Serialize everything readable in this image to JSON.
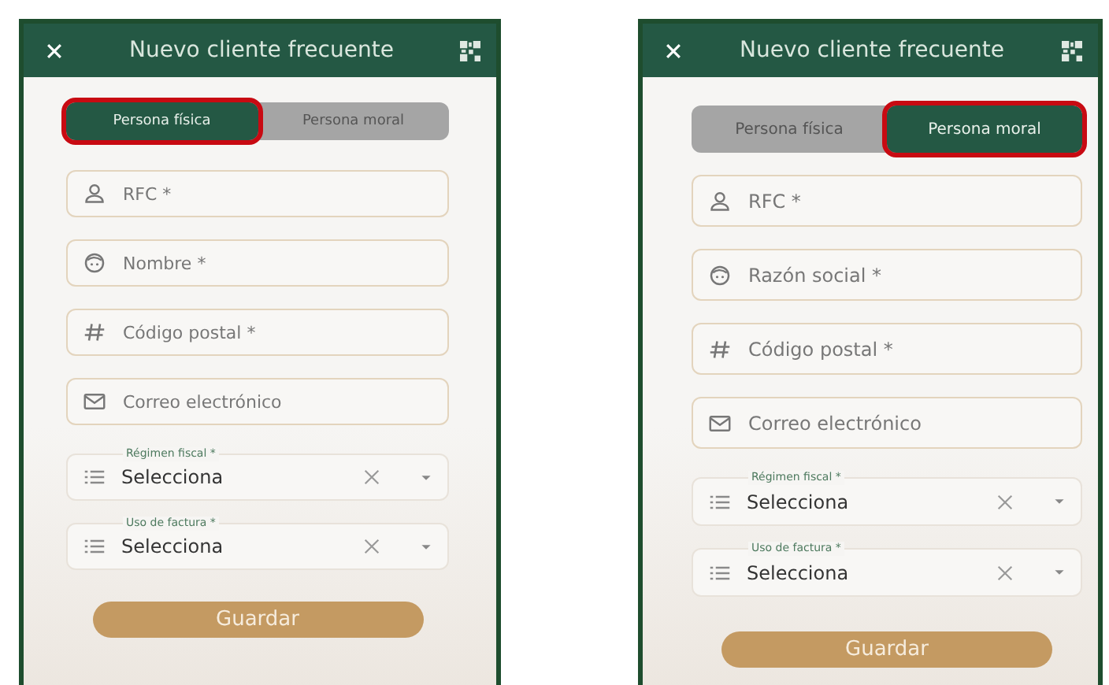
{
  "panels": [
    {
      "title": "Nuevo cliente frecuente",
      "tabs": [
        {
          "label": "Persona física",
          "selected": true
        },
        {
          "label": "Persona moral",
          "selected": false
        }
      ],
      "fields": [
        {
          "kind": "person",
          "placeholder": "RFC *"
        },
        {
          "kind": "face",
          "placeholder": "Nombre *"
        },
        {
          "kind": "number",
          "placeholder": "Código postal *"
        },
        {
          "kind": "email",
          "placeholder": "Correo electrónico"
        },
        {
          "kind": "select",
          "label": "Régimen fiscal *",
          "value": "Selecciona"
        },
        {
          "kind": "select",
          "label": "Uso de factura *",
          "value": "Selecciona"
        }
      ],
      "button": "Guardar"
    },
    {
      "title": "Nuevo cliente frecuente",
      "tabs": [
        {
          "label": "Persona física",
          "selected": false
        },
        {
          "label": "Persona moral",
          "selected": true
        }
      ],
      "fields": [
        {
          "kind": "person",
          "placeholder": "RFC *"
        },
        {
          "kind": "face",
          "placeholder": "Razón social *"
        },
        {
          "kind": "number",
          "placeholder": "Código postal *"
        },
        {
          "kind": "email",
          "placeholder": "Correo electrónico"
        },
        {
          "kind": "select",
          "label": "Régimen fiscal *",
          "value": "Selecciona"
        },
        {
          "kind": "select",
          "label": "Uso de factura *",
          "value": "Selecciona"
        }
      ],
      "button": "Guardar"
    }
  ]
}
